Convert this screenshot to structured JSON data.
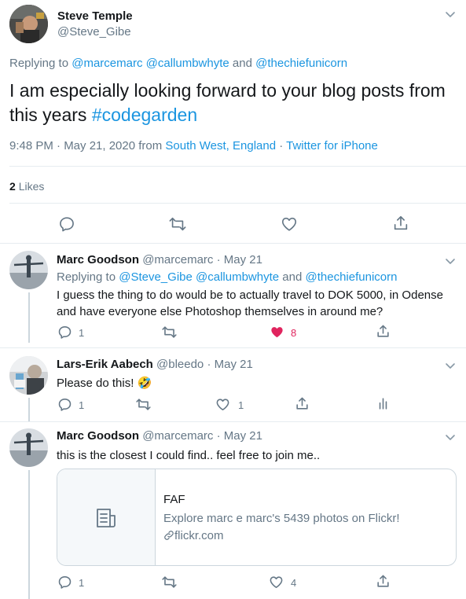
{
  "main_tweet": {
    "author_name": "Steve Temple",
    "author_handle": "@Steve_Gibe",
    "replying_prefix": "Replying to ",
    "replying_1": "@marcemarc",
    "replying_2": "@callumbwhyte",
    "replying_and": " and ",
    "replying_3": "@thechiefunicorn",
    "text_1": "I am especially looking forward to your blog posts from",
    "text_2": "this years ",
    "hashtag": "#codegarden",
    "meta_time": "9:48 PM · May 21, 2020 from ",
    "meta_location": "South West, England",
    "meta_sep": " · ",
    "meta_source": "Twitter for iPhone",
    "likes_count": "2",
    "likes_label": "Likes"
  },
  "replies": [
    {
      "name": "Marc Goodson",
      "handle": "@marcemarc",
      "date": "· May 21",
      "replying_prefix": "Replying to ",
      "replying_1": "@Steve_Gibe",
      "replying_2": "@callumbwhyte",
      "replying_and": " and ",
      "replying_3": "@thechiefunicorn",
      "text_1": "I guess the thing to do would be to actually travel to DOK 5000, in Odense",
      "text_2": "and have everyone else Photoshop themselves in around me?",
      "reply_count": "1",
      "like_count": "8"
    },
    {
      "name": "Lars-Erik Aabech",
      "handle": "@bleedo",
      "date": "· May 21",
      "text_1": "Please do this!",
      "emoji": "🤣",
      "reply_count": "1",
      "like_count": "1"
    },
    {
      "name": "Marc Goodson",
      "handle": "@marcemarc",
      "date": "· May 21",
      "text_1": "this is the closest I could find.. feel free to join me..",
      "card_title": "FAF",
      "card_desc": "Explore marc e marc's 5439 photos on Flickr!",
      "card_domain": "flickr.com",
      "reply_count": "1",
      "like_count": "4"
    }
  ],
  "colors": {
    "link": "#1b95e0",
    "secondary": "#657786",
    "like_active": "#e0245e",
    "border": "#e6ecf0"
  },
  "icons": [
    "chevron-down-icon",
    "reply-icon",
    "retweet-icon",
    "like-icon",
    "share-icon",
    "analytics-icon",
    "document-icon",
    "link-icon"
  ]
}
